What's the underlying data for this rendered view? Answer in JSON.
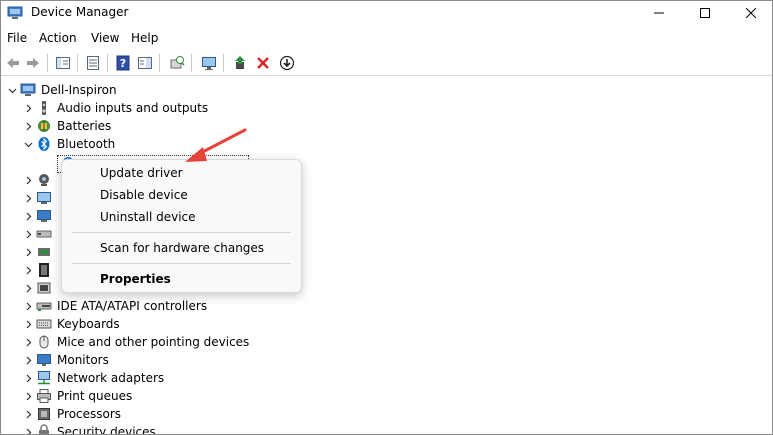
{
  "window": {
    "title": "Device Manager",
    "controls": [
      "minimize",
      "maximize",
      "close"
    ]
  },
  "menu": [
    "File",
    "Action",
    "View",
    "Help"
  ],
  "toolbar": [
    "back-icon",
    "forward-icon",
    "properties-pane-icon",
    "view-icon",
    "help-icon",
    "show-pane-icon",
    "scan-hardware-icon",
    "monitor-icon",
    "update-driver-icon",
    "uninstall-icon",
    "disable-icon"
  ],
  "tree": {
    "root": "Dell-Inspiron",
    "items": [
      {
        "label": "Audio inputs and outputs",
        "icon": "speaker-icon",
        "expanded": false
      },
      {
        "label": "Batteries",
        "icon": "battery-icon",
        "expanded": false
      },
      {
        "label": "Bluetooth",
        "icon": "bluetooth-icon",
        "expanded": true
      },
      {
        "label": "IDE ATA/ATAPI controllers",
        "icon": "ide-controller-icon",
        "expanded": false
      },
      {
        "label": "Keyboards",
        "icon": "keyboard-icon",
        "expanded": false
      },
      {
        "label": "Mice and other pointing devices",
        "icon": "mouse-icon",
        "expanded": false
      },
      {
        "label": "Monitors",
        "icon": "monitor-icon",
        "expanded": false
      },
      {
        "label": "Network adapters",
        "icon": "network-icon",
        "expanded": false
      },
      {
        "label": "Print queues",
        "icon": "printer-icon",
        "expanded": false
      },
      {
        "label": "Processors",
        "icon": "processor-icon",
        "expanded": false
      },
      {
        "label": "Security devices",
        "icon": "security-icon",
        "expanded": false
      }
    ]
  },
  "context_menu": {
    "items": [
      "Update driver",
      "Disable device",
      "Uninstall device",
      "Scan for hardware changes",
      "Properties"
    ]
  },
  "colors": {
    "accent": "#0067c0",
    "arrow": "#e8413c",
    "close_red": "#d42a2a",
    "update_green": "#2b8a3e"
  }
}
